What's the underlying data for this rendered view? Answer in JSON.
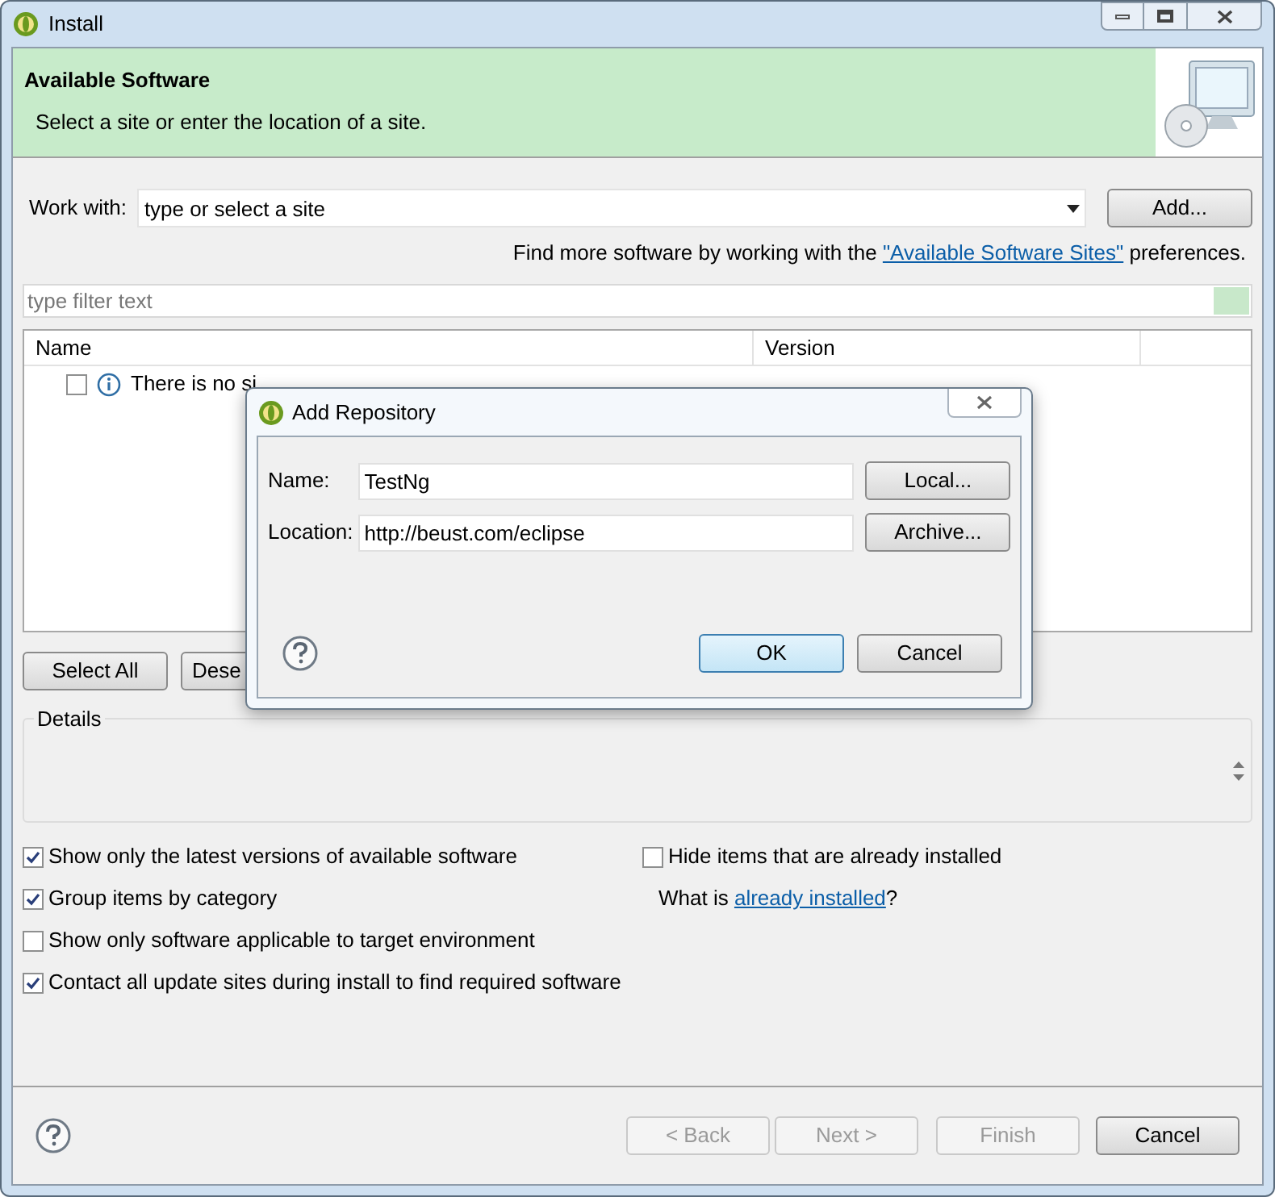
{
  "window": {
    "title": "Install"
  },
  "header": {
    "title": "Available Software",
    "subtitle": "Select a site or enter the location of a site."
  },
  "work_with": {
    "label": "Work with:",
    "placeholder": "type or select a site",
    "button": "Add..."
  },
  "hint": {
    "before": "Find more software by working with the ",
    "link": "\"Available Software Sites\"",
    "after": " preferences."
  },
  "filter": {
    "placeholder": "type filter text"
  },
  "table": {
    "columns": [
      "Name",
      "Version"
    ],
    "rows": [
      {
        "text": "There is no si",
        "checked": false
      }
    ]
  },
  "table_buttons": [
    "Select All",
    "Dese"
  ],
  "details": {
    "title": "Details"
  },
  "left_options": [
    {
      "label": "Show only the latest versions of available software",
      "checked": true
    },
    {
      "label": "Group items by category",
      "checked": true
    },
    {
      "label": "Show only software applicable to target environment",
      "checked": false
    },
    {
      "label": "Contact all update sites during install to find required software",
      "checked": true
    }
  ],
  "right_options": [
    {
      "label": "Hide items that are already installed",
      "checked": false
    }
  ],
  "installed_hint": {
    "before": "What is ",
    "link": "already installed",
    "after": "?"
  },
  "buttons": [
    {
      "label": "< Back",
      "disabled": true
    },
    {
      "label": "Next >",
      "disabled": true
    },
    {
      "label": "Finish",
      "disabled": true
    },
    {
      "label": "Cancel",
      "disabled": false
    }
  ],
  "dialog": {
    "title": "Add Repository",
    "fields": [
      {
        "label": "Name:",
        "value": "TestNg",
        "button": "Local..."
      },
      {
        "label": "Location:",
        "value": "http://beust.com/eclipse",
        "button": "Archive..."
      }
    ],
    "buttons": [
      {
        "label": "OK",
        "default": true
      },
      {
        "label": "Cancel",
        "default": false
      }
    ]
  }
}
